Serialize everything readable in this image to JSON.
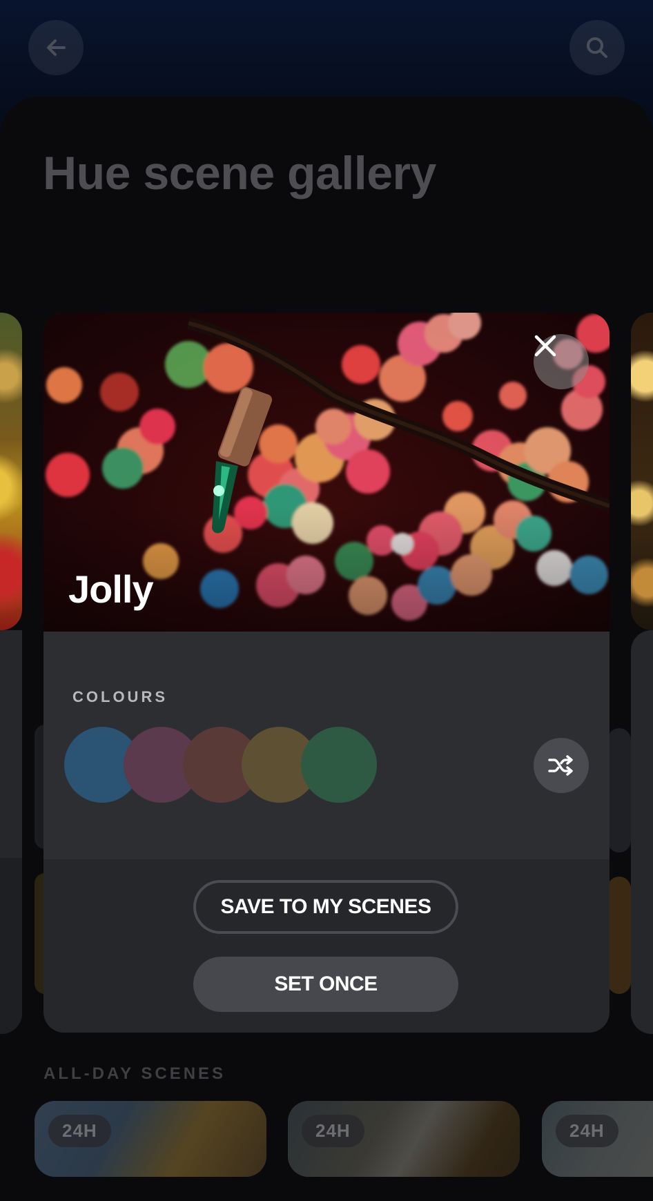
{
  "header": {
    "back_icon": "arrow-left-icon",
    "search_icon": "search-icon",
    "title": "Hue scene gallery"
  },
  "modal": {
    "scene_name": "Jolly",
    "close_icon": "close-icon",
    "colours_label": "COLOURS",
    "swatches": [
      {
        "name": "blue",
        "color": "#2b5374"
      },
      {
        "name": "plum",
        "color": "#5a3a4c"
      },
      {
        "name": "rust",
        "color": "#5a3a36"
      },
      {
        "name": "ochre",
        "color": "#5e5033"
      },
      {
        "name": "green",
        "color": "#2e5a44"
      }
    ],
    "shuffle_icon": "shuffle-icon",
    "save_label": "SAVE TO MY SCENES",
    "set_once_label": "SET ONCE"
  },
  "all_day": {
    "section_label": "ALL-DAY SCENES",
    "tiles": [
      {
        "badge": "24H"
      },
      {
        "badge": "24H"
      },
      {
        "badge": "24H"
      }
    ]
  }
}
